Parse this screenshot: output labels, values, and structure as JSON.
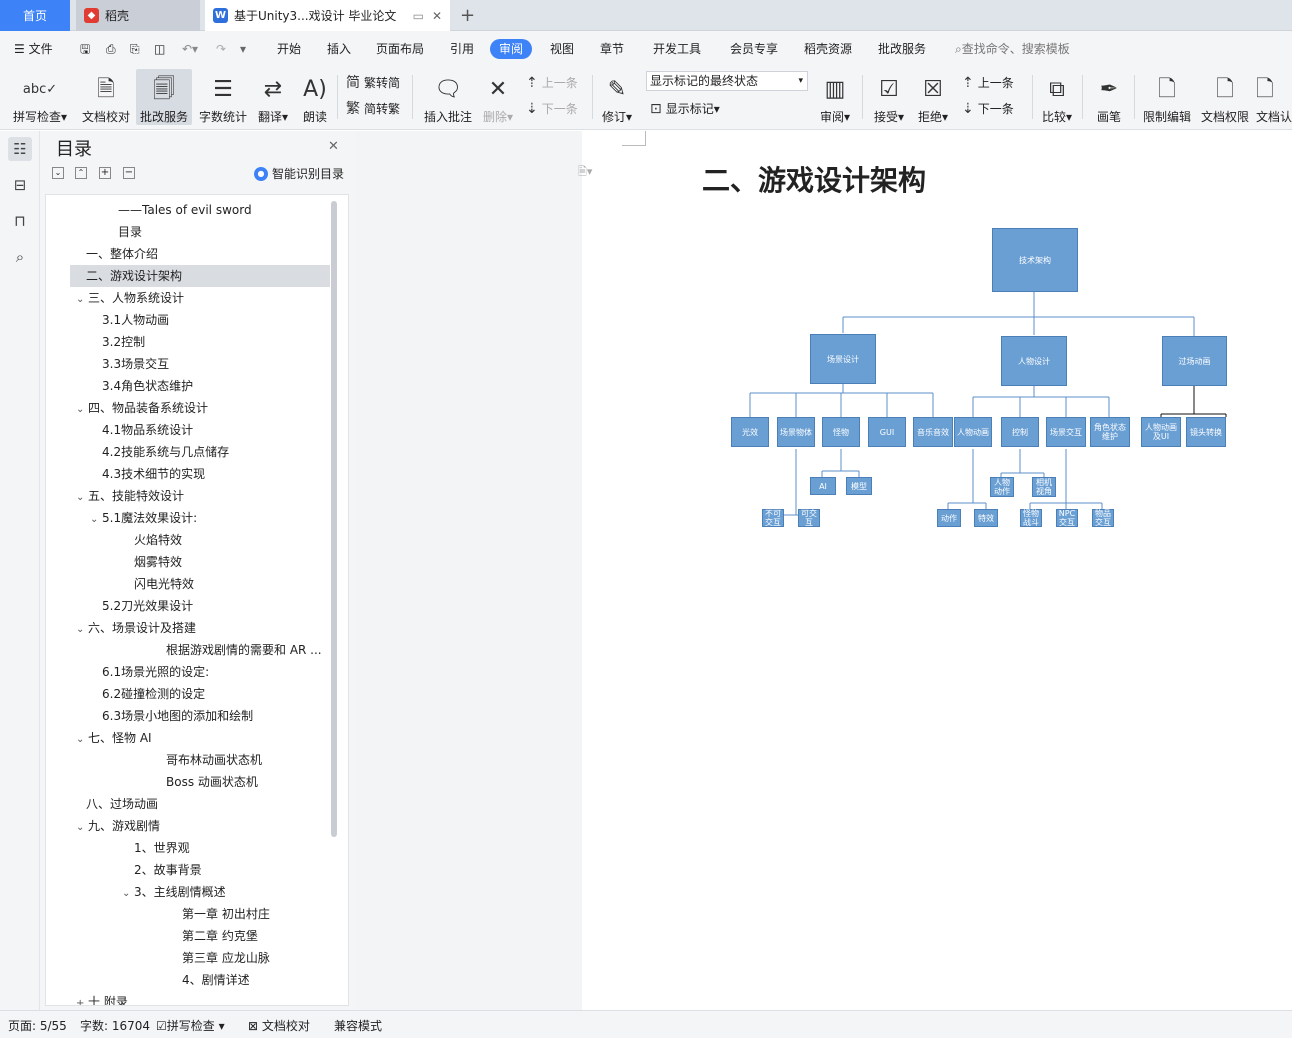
{
  "tabs": {
    "home": "首页",
    "daoke": "稻壳",
    "doc": "基于Unity3...戏设计 毕业论文"
  },
  "menu": {
    "file": "文件",
    "items": [
      "开始",
      "插入",
      "页面布局",
      "引用",
      "审阅",
      "视图",
      "章节",
      "开发工具",
      "会员专享",
      "稻壳资源",
      "批改服务"
    ],
    "search": "查找命令、搜索模板"
  },
  "ribbon": {
    "spell": "拼写检查",
    "proof": "文档校对",
    "batch": "批改服务",
    "count": "字数统计",
    "translate": "翻译",
    "read": "朗读",
    "t2s": "繁转简",
    "s2t": "简转繁",
    "insert_comment": "插入批注",
    "delete": "删除",
    "prev": "上一条",
    "next": "下一条",
    "track": "修订",
    "display_select": "显示标记的最终状态",
    "show_markup": "显示标记",
    "review": "审阅",
    "accept": "接受",
    "reject": "拒绝",
    "prev2": "上一条",
    "next2": "下一条",
    "compare": "比较",
    "pen": "画笔",
    "restrict": "限制编辑",
    "perm": "文档权限",
    "cert": "文档认"
  },
  "toc": {
    "title": "目录",
    "smart": "智能识别目录",
    "items": [
      "——Tales of evil sword",
      "目录",
      "一、整体介绍",
      "二、游戏设计架构",
      "三、人物系统设计",
      "3.1人物动画",
      "3.2控制",
      "3.3场景交互",
      "3.4角色状态维护",
      "四、物品装备系统设计",
      "4.1物品系统设计",
      "4.2技能系统与几点储存",
      "4.3技术细节的实现",
      "五、技能特效设计",
      "5.1魔法效果设计:",
      "火焰特效",
      "烟雾特效",
      "闪电光特效",
      "5.2刀光效果设计",
      "六、场景设计及搭建",
      "根据游戏剧情的需要和 AR ...",
      "6.1场景光照的设定:",
      "6.2碰撞检测的设定",
      "6.3场景小地图的添加和绘制",
      "七、怪物 AI",
      "哥布林动画状态机",
      "Boss 动画状态机",
      "八、过场动画",
      "九、游戏剧情",
      "1、世界观",
      "2、故事背景",
      "3、主线剧情概述",
      "第一章 初出村庄",
      "第二章 约克堡",
      "第三章 应龙山脉",
      "4、剧情详述",
      "十  附录"
    ]
  },
  "doc": {
    "heading": "二、游戏设计架构",
    "diagram": {
      "root": "技术架构",
      "l1": [
        "场景设计",
        "人物设计",
        "过场动画"
      ],
      "l2": [
        "光效",
        "场景物体",
        "怪物",
        "GUI",
        "音乐音效",
        "人物动画",
        "控制",
        "场景交互",
        "角色状态维护",
        "人物动画及UI",
        "镜头转换"
      ],
      "l3": [
        "不可交互",
        "可交互",
        "AI",
        "模型",
        "动作",
        "特效",
        "人物动作",
        "相机视角",
        "怪物战斗",
        "NPC交互",
        "物品交互"
      ]
    }
  },
  "status": {
    "page": "页面: 5/55",
    "words": "字数: 16704",
    "spell": "拼写检查",
    "proof": "文档校对",
    "compat": "兼容模式"
  }
}
